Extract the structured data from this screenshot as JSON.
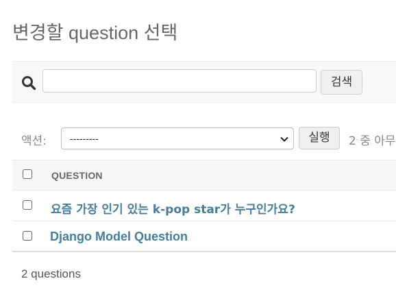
{
  "page": {
    "title": "변경할 question 선택"
  },
  "search": {
    "placeholder": "",
    "value": "",
    "button_label": "검색"
  },
  "actions": {
    "label": "액션:",
    "selected_option": "---------",
    "run_label": "실행",
    "selection_counter": "2 중 아무"
  },
  "table": {
    "column_header": "QUESTION",
    "rows": [
      {
        "text": "요즘 가장 인기 있는 k-pop star가 누구인가요?"
      },
      {
        "text": "Django Model Question"
      }
    ]
  },
  "footer": {
    "result_count": "2 questions"
  },
  "icons": {
    "search": "search-icon",
    "select_arrow": "chevron-down-icon"
  },
  "colors": {
    "link": "#447e9b",
    "header_bg": "#f6f6f6",
    "toolbar_bg": "#f8f8f8"
  }
}
